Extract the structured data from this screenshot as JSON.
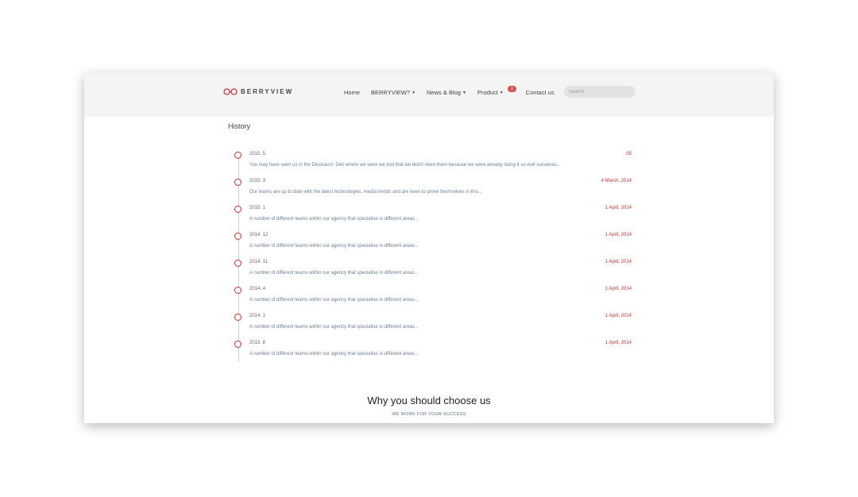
{
  "brand": {
    "name": "BERRYVIEW"
  },
  "nav": {
    "items": [
      {
        "label": "Home",
        "has_caret": false
      },
      {
        "label": "BERRYVIEW?",
        "has_caret": true
      },
      {
        "label": "News & Blog",
        "has_caret": true
      },
      {
        "label": "Product",
        "has_caret": true,
        "badge": "1"
      },
      {
        "label": "Contact us",
        "has_caret": false
      }
    ],
    "search_placeholder": "Search"
  },
  "history": {
    "title": "History",
    "items": [
      {
        "date": "2015. 5",
        "right": "05",
        "text": "You may have seen us in the Dinosaurs' Den where we were we told that we didn't need them because we were already doing it so well ourselves..."
      },
      {
        "date": "2015. 3",
        "right": "4 March, 2014",
        "text": "Our teams are up to date with the latest technologies, media trends and are keen to prove themselves in this..."
      },
      {
        "date": "2015. 1",
        "right": "1 April, 2014",
        "text": "A number of different teams within our agency that specialise in different areas..."
      },
      {
        "date": "2014. 12",
        "right": "1 April, 2014",
        "text": "A number of different teams within our agency that specialise in different areas..."
      },
      {
        "date": "2014. 11",
        "right": "1 April, 2014",
        "text": "A number of different teams within our agency that specialise in different areas..."
      },
      {
        "date": "2014. 4",
        "right": "1 April, 2014",
        "text": "A number of different teams within our agency that specialise in different areas..."
      },
      {
        "date": "2014. 1",
        "right": "1 April, 2014",
        "text": "A number of different teams within our agency that specialise in different areas..."
      },
      {
        "date": "2013. 8",
        "right": "1 April, 2014",
        "text": "A number of different teams within our agency that specialise in different areas..."
      }
    ]
  },
  "why": {
    "title": "Why you should choose us",
    "subtitle": "WE WORK FOR YOUR SUCCESS"
  },
  "colors": {
    "accent": "#c9302c",
    "badge": "#d9534f",
    "navbar_bg": "#f4f4f4",
    "muted_text": "#6d7f93"
  },
  "icons": {
    "logo": "glasses-logo-icon",
    "caret": "caret-down-icon"
  }
}
